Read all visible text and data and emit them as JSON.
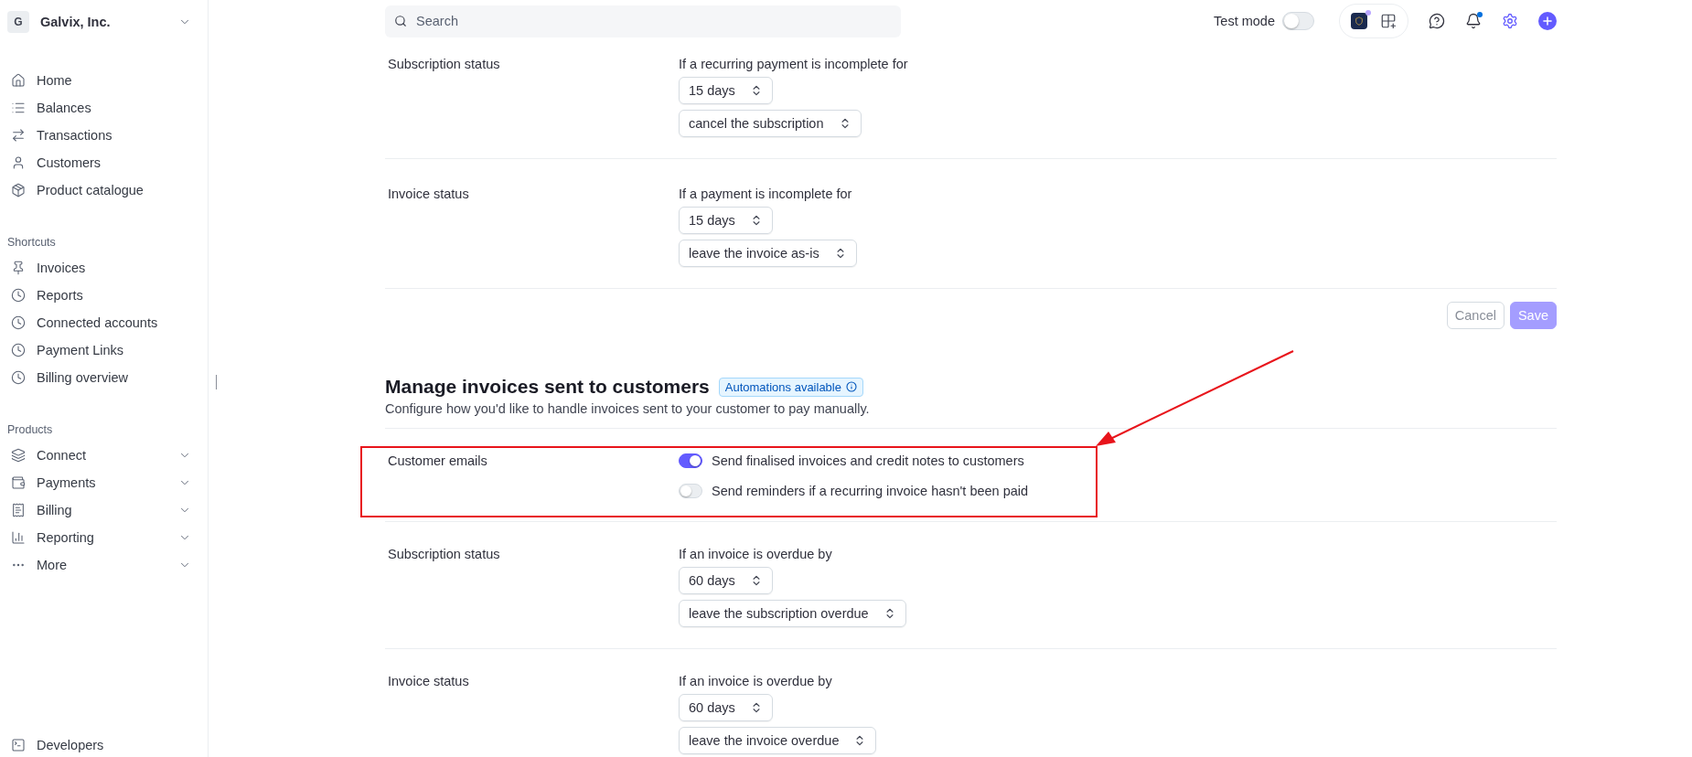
{
  "org": {
    "initial": "G",
    "name": "Galvix, Inc."
  },
  "nav": [
    {
      "label": "Home"
    },
    {
      "label": "Balances"
    },
    {
      "label": "Transactions"
    },
    {
      "label": "Customers"
    },
    {
      "label": "Product catalogue"
    }
  ],
  "shortcuts": {
    "title": "Shortcuts",
    "items": [
      {
        "label": "Invoices"
      },
      {
        "label": "Reports"
      },
      {
        "label": "Connected accounts"
      },
      {
        "label": "Payment Links"
      },
      {
        "label": "Billing overview"
      }
    ]
  },
  "products": {
    "title": "Products",
    "items": [
      {
        "label": "Connect"
      },
      {
        "label": "Payments"
      },
      {
        "label": "Billing"
      },
      {
        "label": "Reporting"
      },
      {
        "label": "More"
      }
    ]
  },
  "developers": {
    "label": "Developers"
  },
  "search": {
    "placeholder": "Search"
  },
  "test_mode": {
    "label": "Test mode",
    "on": false
  },
  "payment_rows": [
    {
      "kind": "select",
      "label": "Subscription status",
      "condition": "If a recurring payment is incomplete for",
      "selects": [
        "15 days",
        "cancel the subscription"
      ]
    },
    {
      "kind": "select",
      "label": "Invoice status",
      "condition": "If a payment is incomplete for",
      "selects": [
        "15 days",
        "leave the invoice as-is"
      ]
    }
  ],
  "actions": [
    {
      "label": "Cancel",
      "kind": "secondary",
      "disabled": true
    },
    {
      "label": "Save",
      "kind": "primary",
      "disabled": true
    }
  ],
  "invoice_section": {
    "title": "Manage invoices sent to customers",
    "badge": "Automations available",
    "description": "Configure how you'd like to handle invoices sent to your customer to pay manually.",
    "rows": [
      {
        "kind": "toggles",
        "label": "Customer emails",
        "toggles": [
          {
            "label": "Send finalised invoices and credit notes to customers",
            "on": true
          },
          {
            "label": "Send reminders if a recurring invoice hasn't been paid",
            "on": false
          }
        ]
      },
      {
        "kind": "select",
        "label": "Subscription status",
        "condition": "If an invoice is overdue by",
        "selects": [
          "60 days",
          "leave the subscription overdue"
        ]
      },
      {
        "kind": "select",
        "label": "Invoice status",
        "condition": "If an invoice is overdue by",
        "selects": [
          "60 days",
          "leave the invoice overdue"
        ]
      }
    ]
  }
}
